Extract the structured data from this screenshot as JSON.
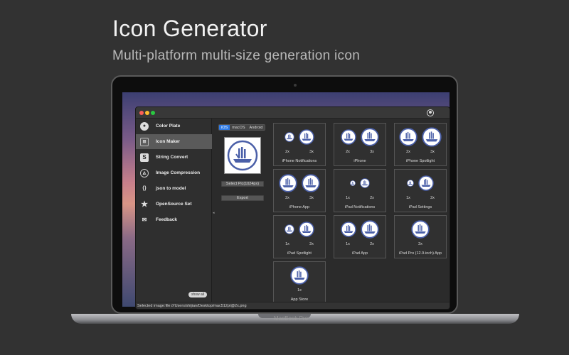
{
  "hero": {
    "title": "Icon Generator",
    "subtitle": "Multi-platform multi-size generation icon"
  },
  "device": {
    "label": "MacBook Pro"
  },
  "colors": {
    "accent": "#2f7be6",
    "icon_ring": "#4a5fa8"
  },
  "window": {
    "sidebar": {
      "items": [
        {
          "label": "Color Plate",
          "icon": "palette-icon"
        },
        {
          "label": "Icon Maker",
          "icon": "icon-maker-icon",
          "active": true
        },
        {
          "label": "String Convert",
          "icon": "string-icon"
        },
        {
          "label": "Image Compression",
          "icon": "image-icon"
        },
        {
          "label": "json to model",
          "icon": "json-icon"
        },
        {
          "label": "OpenSource Set",
          "icon": "star-icon"
        },
        {
          "label": "Feedback",
          "icon": "feedback-icon"
        }
      ],
      "show_all": "show all"
    },
    "platform_tabs": [
      "iOS",
      "macOS",
      "Android"
    ],
    "selected_platform": "iOS",
    "select_button": "Select Pic(1024px)",
    "export_button": "Export",
    "cards": [
      {
        "label": "iPhone Notifications",
        "scales": [
          "2x",
          "3x"
        ]
      },
      {
        "label": "iPhone",
        "scales": [
          "2x",
          "3x"
        ]
      },
      {
        "label": "iPhone Spotlight",
        "scales": [
          "2x",
          "3x"
        ]
      },
      {
        "label": "iPhone App",
        "scales": [
          "2x",
          "3x"
        ]
      },
      {
        "label": "iPad Notifications",
        "scales": [
          "1x",
          "2x"
        ]
      },
      {
        "label": "iPad Settings",
        "scales": [
          "1x",
          "2x"
        ]
      },
      {
        "label": "iPad Spotlight",
        "scales": [
          "1x",
          "2x"
        ]
      },
      {
        "label": "iPad App",
        "scales": [
          "1x",
          "2x"
        ]
      },
      {
        "label": "iPad Pro (12.9-inch) App",
        "scales": [
          "2x"
        ]
      },
      {
        "label": "App Store",
        "scales": [
          "1x"
        ]
      }
    ],
    "status": "Selected image:file:///Users/shijian/Desktop/mac512pt@2x.png"
  }
}
